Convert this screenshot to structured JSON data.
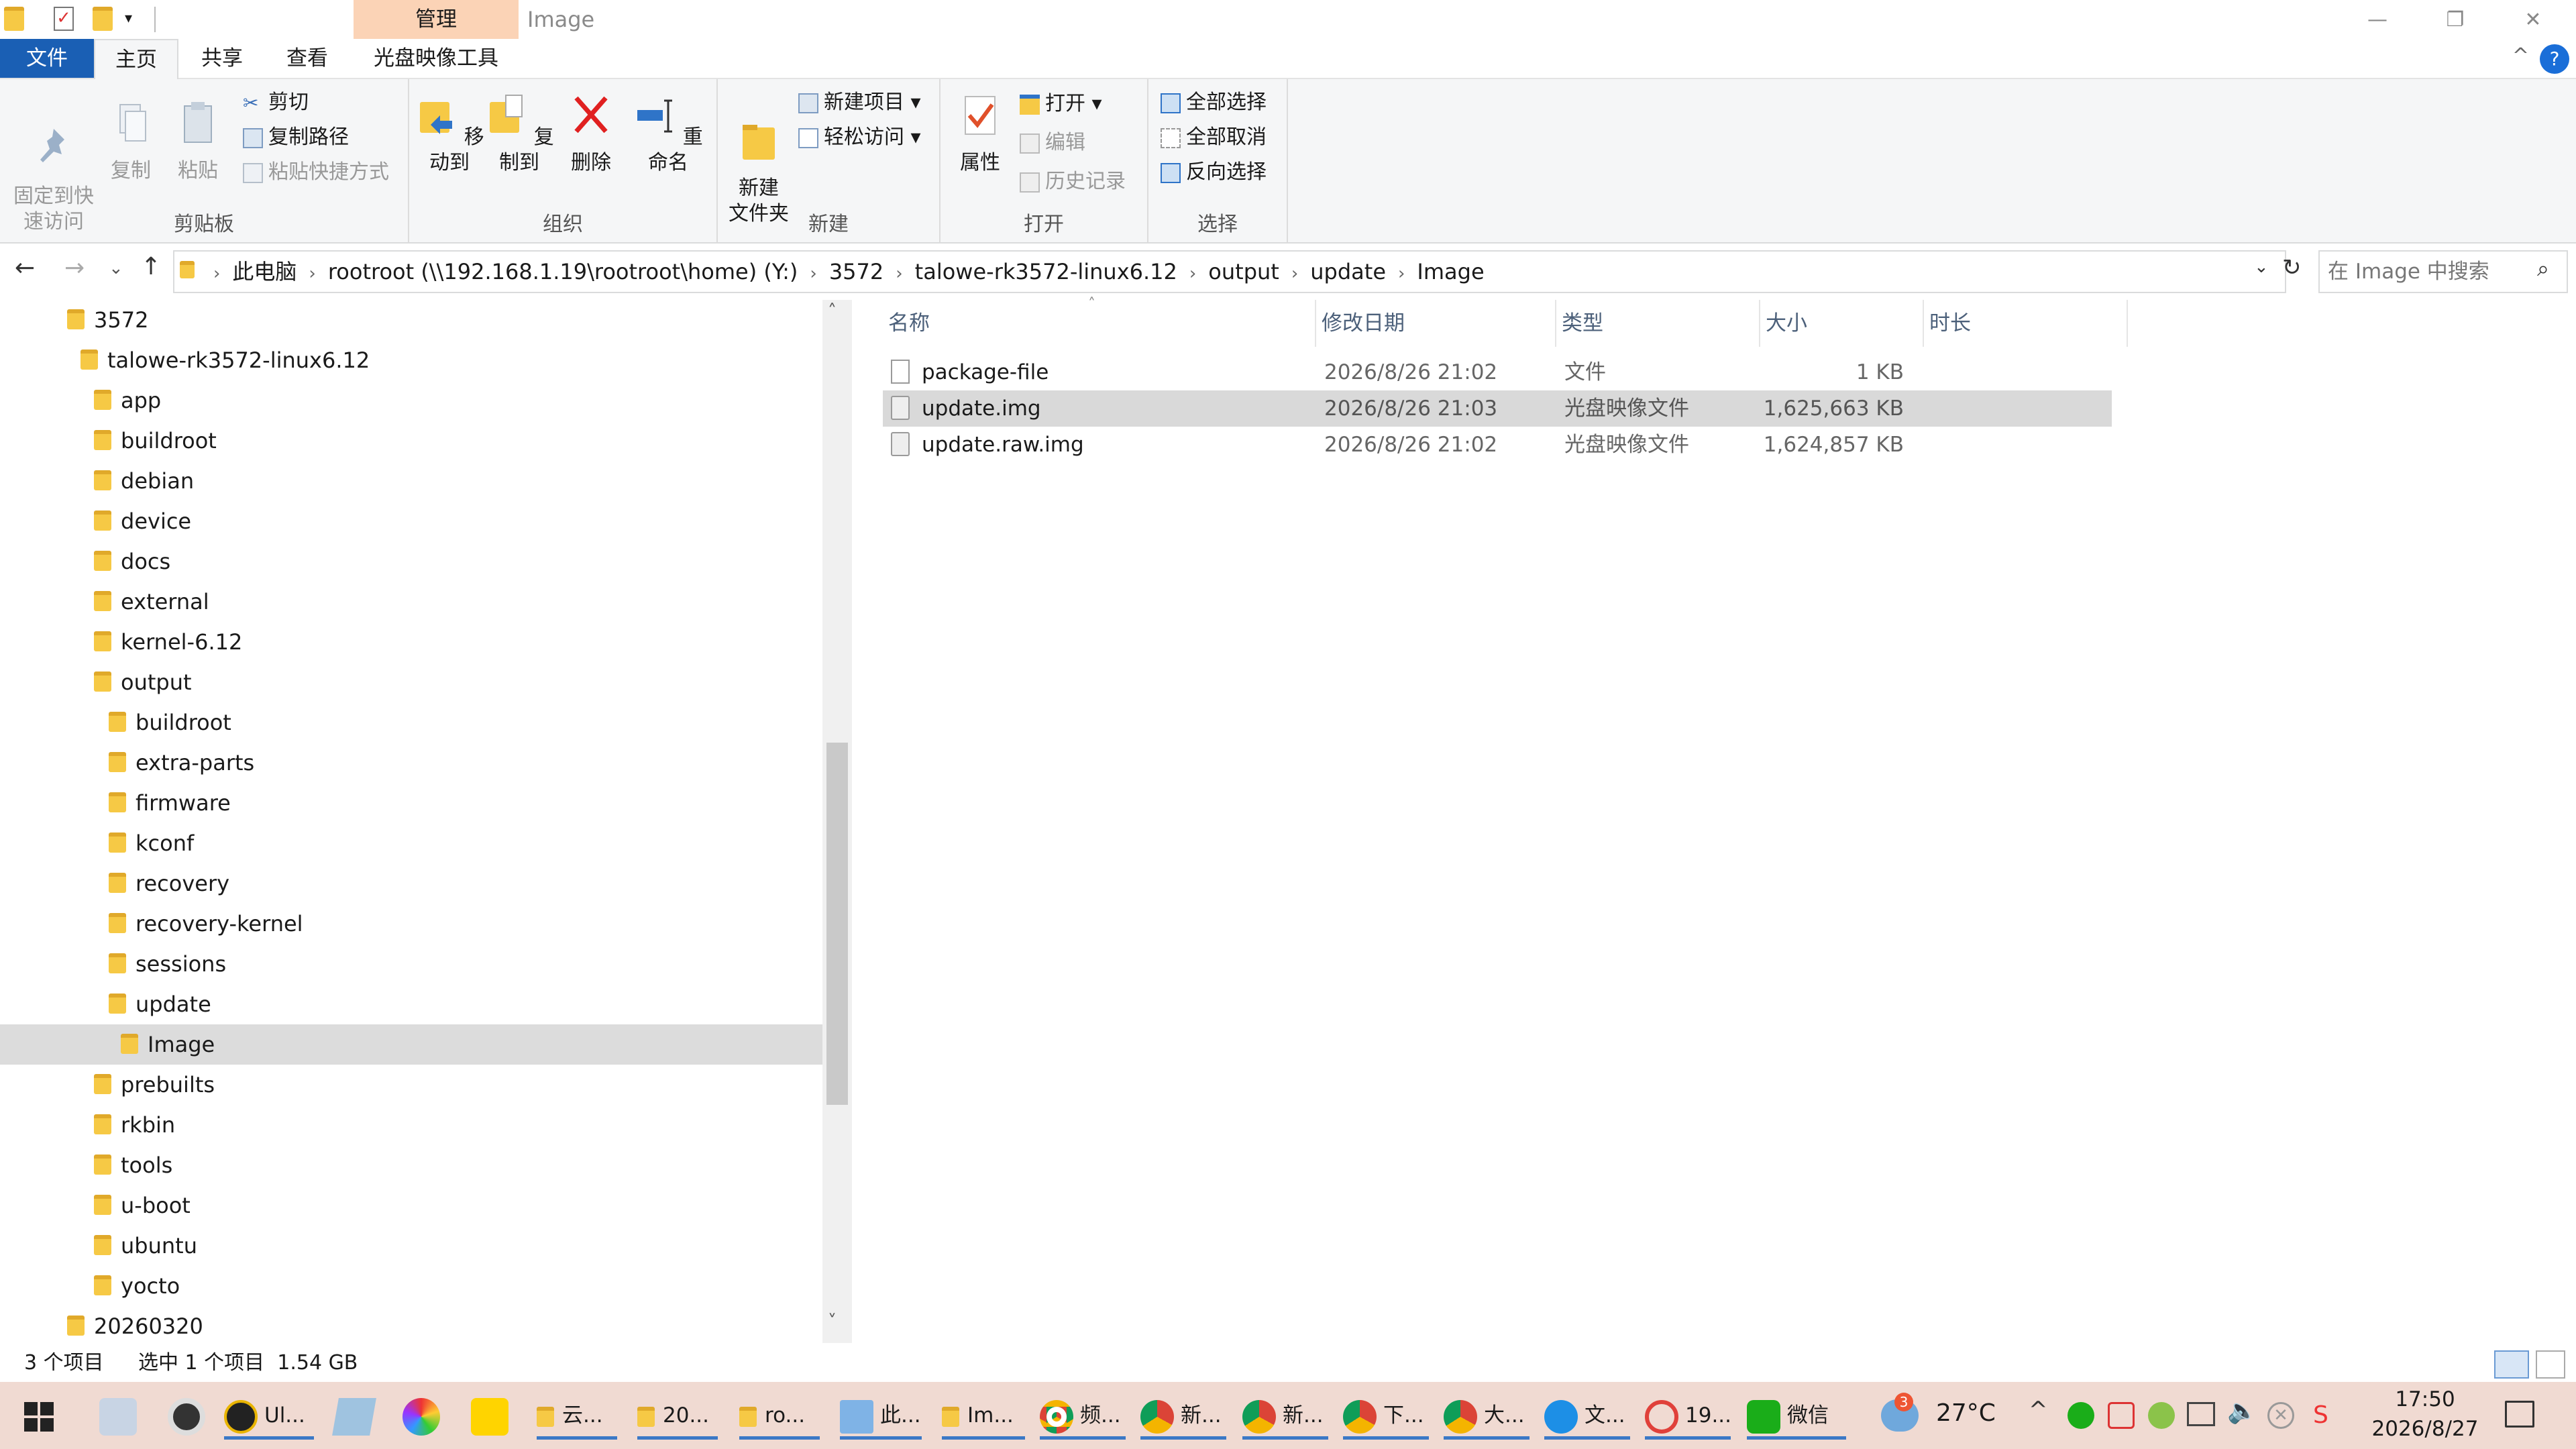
{
  "window": {
    "title": "Image",
    "manage_tab": "管理",
    "minimize": "—",
    "maximize": "❐",
    "close": "✕",
    "help": "?"
  },
  "tabs": {
    "file": "文件",
    "home": "主页",
    "share": "共享",
    "view": "查看",
    "disc_tools": "光盘映像工具"
  },
  "ribbon": {
    "clipboard": {
      "label": "剪贴板",
      "pin": "固定到快\n速访问",
      "copy": "复制",
      "paste": "粘贴",
      "cut": "剪切",
      "copy_path": "复制路径",
      "paste_shortcut": "粘贴快捷方式"
    },
    "organize": {
      "label": "组织",
      "move_to": "移动到",
      "copy_to": "复制到",
      "delete": "删除",
      "rename": "重命名"
    },
    "new": {
      "label": "新建",
      "new_folder": "新建\n文件夹",
      "new_item": "新建项目 ▾",
      "easy_access": "轻松访问 ▾"
    },
    "open": {
      "label": "打开",
      "properties": "属性",
      "open": "打开 ▾",
      "edit": "编辑",
      "history": "历史记录"
    },
    "select": {
      "label": "选择",
      "select_all": "全部选择",
      "select_none": "全部取消",
      "invert": "反向选择"
    }
  },
  "address": {
    "crumbs": [
      "此电脑",
      "rootroot (\\\\192.168.1.19\\rootroot\\home) (Y:)",
      "3572",
      "talowe-rk3572-linux6.12",
      "output",
      "update",
      "Image"
    ],
    "search_placeholder": "在 Image 中搜索"
  },
  "nav": [
    {
      "label": "3572",
      "level": 0
    },
    {
      "label": "talowe-rk3572-linux6.12",
      "level": 1
    },
    {
      "label": "app",
      "level": 2
    },
    {
      "label": "buildroot",
      "level": 2
    },
    {
      "label": "debian",
      "level": 2
    },
    {
      "label": "device",
      "level": 2
    },
    {
      "label": "docs",
      "level": 2
    },
    {
      "label": "external",
      "level": 2
    },
    {
      "label": "kernel-6.12",
      "level": 2
    },
    {
      "label": "output",
      "level": 2
    },
    {
      "label": "buildroot",
      "level": 3
    },
    {
      "label": "extra-parts",
      "level": 3
    },
    {
      "label": "firmware",
      "level": 3
    },
    {
      "label": "kconf",
      "level": 3
    },
    {
      "label": "recovery",
      "level": 3
    },
    {
      "label": "recovery-kernel",
      "level": 3
    },
    {
      "label": "sessions",
      "level": 3
    },
    {
      "label": "update",
      "level": 3
    },
    {
      "label": "Image",
      "level": 4
    },
    {
      "label": "prebuilts",
      "level": 2
    },
    {
      "label": "rkbin",
      "level": 2
    },
    {
      "label": "tools",
      "level": 2
    },
    {
      "label": "u-boot",
      "level": 2
    },
    {
      "label": "ubuntu",
      "level": 2
    },
    {
      "label": "yocto",
      "level": 2
    },
    {
      "label": "20260320",
      "level": 0
    }
  ],
  "columns": {
    "name": "名称",
    "date": "修改日期",
    "type": "类型",
    "size": "大小",
    "duration": "时长"
  },
  "files": [
    {
      "name": "package-file",
      "date": "2026/8/26 21:02",
      "type": "文件",
      "size": "1 KB"
    },
    {
      "name": "update.img",
      "date": "2026/8/26 21:03",
      "type": "光盘映像文件",
      "size": "1,625,663 KB"
    },
    {
      "name": "update.raw.img",
      "date": "2026/8/26 21:02",
      "type": "光盘映像文件",
      "size": "1,624,857 KB"
    }
  ],
  "status": {
    "count": "3 个项目",
    "selected": "选中 1 个项目  1.54 GB"
  },
  "taskbar": {
    "apps": [
      "Ul...",
      "云...",
      "20...",
      "ro...",
      "此...",
      "Im...",
      "频...",
      "新...",
      "新...",
      "下...",
      "大...",
      "文...",
      "19...",
      "微信"
    ],
    "weather": "27°C",
    "time": "17:50",
    "date": "2026/8/27",
    "badge": "3"
  },
  "colors": {
    "accent": "#1a5fb4",
    "manage": "#fbd3b6",
    "taskbar": "#f0dad2",
    "folder": "#f6c945",
    "selected": "#d9d9d9"
  }
}
